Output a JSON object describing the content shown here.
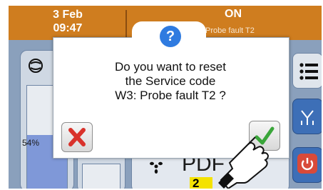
{
  "header": {
    "date": "3 Feb",
    "time": "09:47",
    "status": "ON",
    "status_detail": "Probe fault T2"
  },
  "gauge": {
    "percent_label": "54%",
    "fill_fraction": 0.54
  },
  "center_panel": {
    "text": "PDF"
  },
  "dialog": {
    "info_symbol": "?",
    "lines": [
      "Do you want to reset",
      "the Service code",
      "W3: Probe fault T2 ?"
    ]
  },
  "marker": {
    "label": "2"
  },
  "icons": {
    "info": "question-icon",
    "cancel": "cancel-x-icon",
    "confirm": "checkmark-icon",
    "menu": "menu-list-icon",
    "valve": "valve-icon",
    "power": "power-icon",
    "compressor": "compressor-icon",
    "fan": "fan-icon",
    "pointer": "pointing-hand-icon"
  },
  "colors": {
    "header": "#cf7d1f",
    "info_badge": "#2f7be0",
    "cancel_x": "#d9322b",
    "confirm_check": "#3aa63a",
    "power_button": "#d84a3a"
  }
}
